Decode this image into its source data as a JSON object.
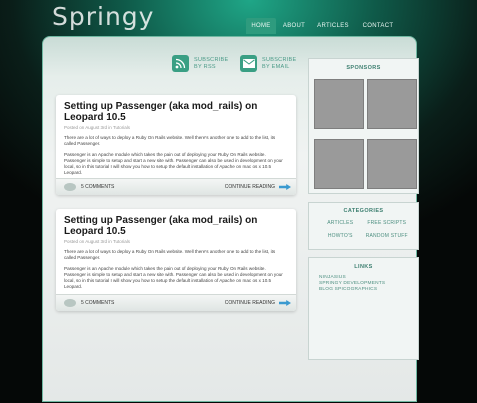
{
  "site": {
    "logo": "Springy"
  },
  "nav": {
    "items": [
      "HOME",
      "ABOUT",
      "ARTICLES",
      "CONTACT"
    ]
  },
  "subscribe": {
    "rss": {
      "line1": "SUBSCRIBE",
      "line2": "BY RSS"
    },
    "email": {
      "line1": "SUBSCRIBE",
      "line2": "BY EMAIL"
    }
  },
  "posts": [
    {
      "title": "Setting up Passenger (aka mod_rails) on Leopard 10.5",
      "meta": "Posted on August 3rd in Tutorials",
      "p1": "There are a lot of ways to deploy a Ruby On Rails website. Well there's another one to add to the list, its called Passenger.",
      "p2": "Passenger is an Apache module which takes the pain out of deploying your Ruby On Rails website. Passenger is simple to setup and start a new site with. Passenger can also be used in development on your local, so in this tutorial I will show you how to setup the default installation of Apache on mac os x 10.5 Leopard.",
      "comments": "5 COMMENTS",
      "continue": "CONTINUE READING"
    },
    {
      "title": "Setting up Passenger (aka mod_rails) on Leopard 10.5",
      "meta": "Posted on August 3rd in Tutorials",
      "p1": "There are a lot of ways to deploy a Ruby On Rails website. Well there's another one to add to the list, its called Passenger.",
      "p2": "Passenger is an Apache module which takes the pain out of deploying your Ruby On Rails website. Passenger is simple to setup and start a new site with. Passenger can also be used in development on your local, so in this tutorial I will show you how to setup the default installation of Apache on mac os x 10.5 Leopard.",
      "comments": "5 COMMENTS",
      "continue": "CONTINUE READING"
    }
  ],
  "sidebar": {
    "sponsors_title": "SPONSORS",
    "categories_title": "CATEGORIES",
    "categories": [
      "ARTICLES",
      "FREE SCRIPTS",
      "HOWTO'S",
      "RANDOM STUFF"
    ],
    "links_title": "LINKS",
    "links": [
      "NINJASIUS",
      "SPRINGY DEVELOPMENTS",
      "BLOG SPICOGRAPHICS"
    ]
  },
  "colors": {
    "accent": "#2e9b7e",
    "link": "#4d8f80",
    "link_arrow": "#3a9ad0"
  }
}
